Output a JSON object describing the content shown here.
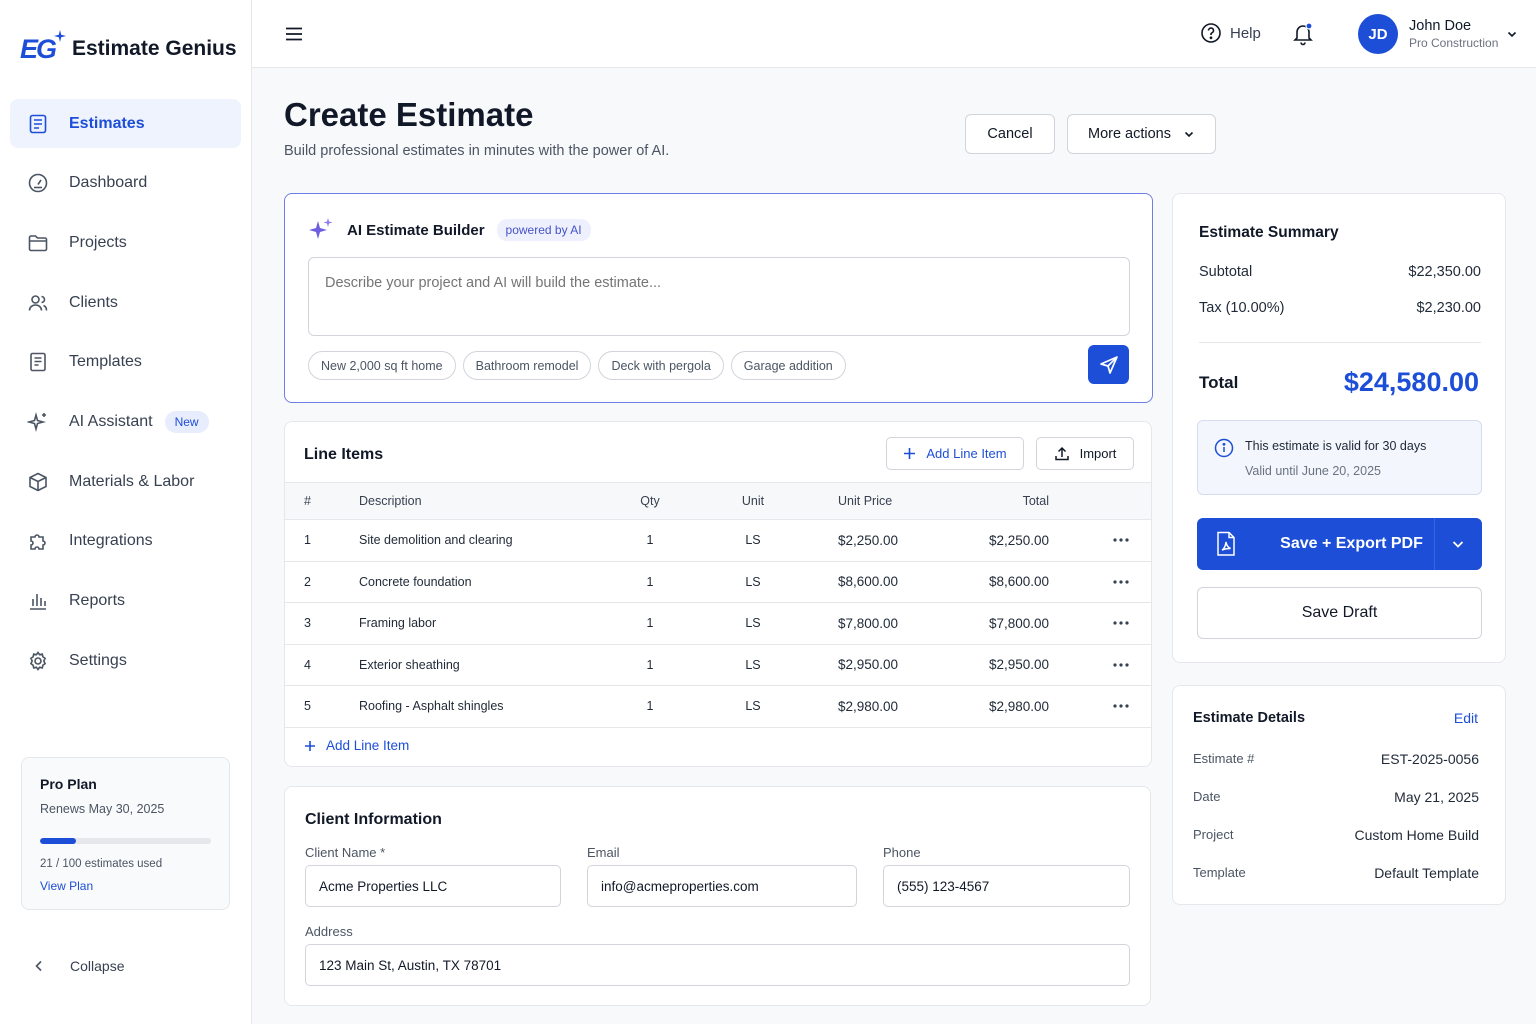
{
  "app": {
    "name": "Estimate Genius",
    "logo_letters": "EG"
  },
  "sidebar": {
    "items": [
      {
        "label": "Estimates",
        "icon": "document-list-icon",
        "active": true
      },
      {
        "label": "Dashboard",
        "icon": "gauge-icon"
      },
      {
        "label": "Projects",
        "icon": "folder-icon"
      },
      {
        "label": "Clients",
        "icon": "users-icon"
      },
      {
        "label": "Templates",
        "icon": "template-icon"
      },
      {
        "label": "AI Assistant",
        "icon": "sparkles-icon",
        "badge": "New"
      },
      {
        "label": "Materials & Labor",
        "icon": "box-icon"
      },
      {
        "label": "Integrations",
        "icon": "puzzle-icon"
      },
      {
        "label": "Reports",
        "icon": "bar-chart-icon"
      },
      {
        "label": "Settings",
        "icon": "gear-icon"
      }
    ],
    "plan": {
      "title": "Pro Plan",
      "renews": "Renews May 30, 2025",
      "used_text": "21 / 100 estimates used",
      "used_fraction": 0.21,
      "link": "View Plan"
    },
    "collapse_label": "Collapse"
  },
  "topbar": {
    "help_label": "Help",
    "notification_dot_color": "#1d4ed8",
    "user": {
      "initials": "JD",
      "name": "John Doe",
      "company": "Pro Construction"
    }
  },
  "header": {
    "title": "Create Estimate",
    "subtitle": "Build professional estimates in minutes with the power of AI.",
    "cancel_label": "Cancel",
    "more_actions_label": "More actions"
  },
  "ai_builder": {
    "title": "AI Estimate Builder",
    "badge": "powered by AI",
    "placeholder": "Describe your project and AI will build the estimate...",
    "suggestions": [
      "New 2,000 sq ft home",
      "Bathroom remodel",
      "Deck with pergola",
      "Garage addition"
    ]
  },
  "line_items": {
    "title": "Line Items",
    "add_label": "Add Line Item",
    "import_label": "Import",
    "columns": [
      "#",
      "Description",
      "Qty",
      "Unit",
      "Unit Price",
      "Total"
    ],
    "rows": [
      {
        "num": "1",
        "description": "Site demolition and clearing",
        "qty": "1",
        "unit": "LS",
        "unit_price": "$2,250.00",
        "total": "$2,250.00"
      },
      {
        "num": "2",
        "description": "Concrete foundation",
        "qty": "1",
        "unit": "LS",
        "unit_price": "$8,600.00",
        "total": "$8,600.00"
      },
      {
        "num": "3",
        "description": "Framing labor",
        "qty": "1",
        "unit": "LS",
        "unit_price": "$7,800.00",
        "total": "$7,800.00"
      },
      {
        "num": "4",
        "description": "Exterior sheathing",
        "qty": "1",
        "unit": "LS",
        "unit_price": "$2,950.00",
        "total": "$2,950.00"
      },
      {
        "num": "5",
        "description": "Roofing - Asphalt shingles",
        "qty": "1",
        "unit": "LS",
        "unit_price": "$2,980.00",
        "total": "$2,980.00"
      }
    ],
    "footer_add_label": "Add Line Item"
  },
  "client": {
    "title": "Client Information",
    "name_label": "Client Name *",
    "name_value": "Acme Properties LLC",
    "email_label": "Email",
    "email_value": "info@acmeproperties.com",
    "phone_label": "Phone",
    "phone_value": "(555) 123-4567",
    "address_label": "Address",
    "address_value": "123 Main St, Austin, TX 78701"
  },
  "summary": {
    "title": "Estimate Summary",
    "subtotal_label": "Subtotal",
    "subtotal_value": "$22,350.00",
    "tax_label": "Tax (10.00%)",
    "tax_value": "$2,230.00",
    "total_label": "Total",
    "total_value": "$24,580.00",
    "valid_text": "This estimate is valid for 30 days",
    "valid_until": "Valid until June 20, 2025",
    "export_label": "Save + Export PDF",
    "draft_label": "Save Draft"
  },
  "details": {
    "title": "Estimate Details",
    "edit_label": "Edit",
    "rows": [
      {
        "label": "Estimate #",
        "value": "EST-2025-0056"
      },
      {
        "label": "Date",
        "value": "May 21, 2025"
      },
      {
        "label": "Project",
        "value": "Custom Home Build"
      },
      {
        "label": "Template",
        "value": "Default Template"
      }
    ]
  },
  "colors": {
    "accent": "#1d4ed8",
    "ai_border": "#6d7ee8"
  }
}
